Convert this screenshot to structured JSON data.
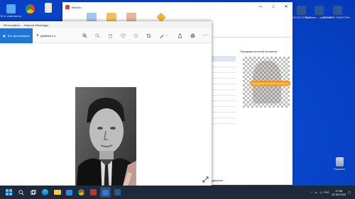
{
  "desktop": {
    "left_icons": [
      {
        "label": "Этот компьютер",
        "color": "#5aa9f2"
      },
      {
        "label": "",
        "color": "#e8e8e8"
      }
    ],
    "right_icons": [
      {
        "label": "СПИСОК СПИНЕ...",
        "color": "#2b5797"
      },
      {
        "label": "Корочки ... районово",
        "color": "#2b5797"
      },
      {
        "label": "СПИСОК УЧАСТНИ...",
        "color": "#2b5797"
      }
    ],
    "recycle_bin": {
      "label": "Корзина"
    }
  },
  "background_window": {
    "title": "BrezGo",
    "controls": {
      "minimize": "—",
      "maximize": "□",
      "close": "✕"
    },
    "preview_title": "Предварительный просмотр",
    "preview_badge": "Предварительный просмотр",
    "status_text": "поддержки"
  },
  "photos_window": {
    "title": "Фотографии — Шаухов Михалддо",
    "all_photos_label": "Все фотографии",
    "add_label": "Добавить в",
    "toolbar_icons": [
      "zoom-in-icon",
      "zoom-out-icon",
      "delete-icon",
      "favorite-icon",
      "rotate-icon",
      "crop-icon",
      "edit-icon",
      "share-icon",
      "print-icon",
      "more-icon"
    ]
  },
  "taskbar": {
    "language": "РУС",
    "time": "17:55",
    "date": "02.06.2022"
  },
  "colors": {
    "accent": "#1e76d6",
    "desktop": "#0b4fd6",
    "taskbar": "#1d2a3c",
    "badge": "#f39a1e"
  }
}
